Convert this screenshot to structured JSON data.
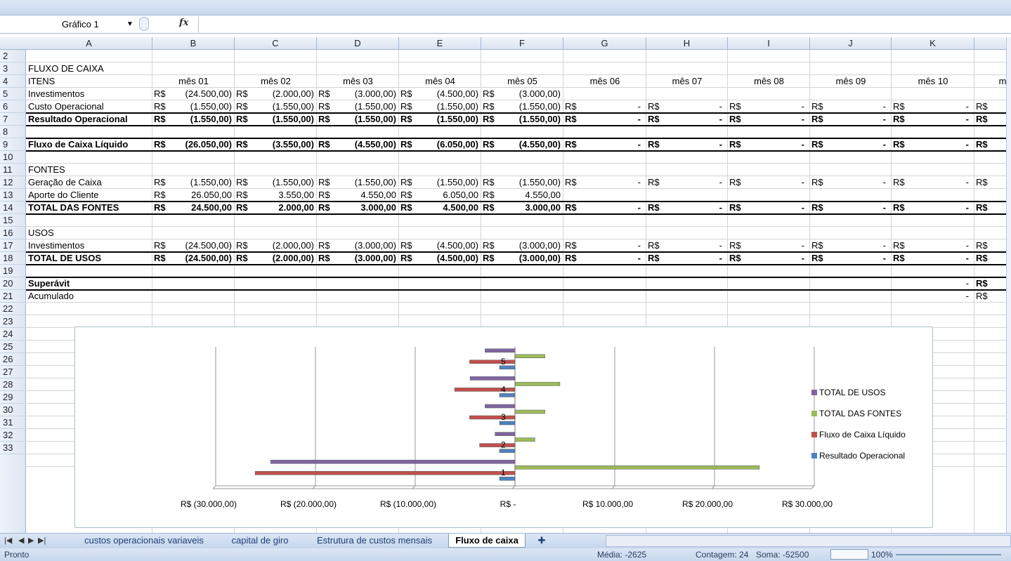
{
  "name_box": "Gráfico 1",
  "fx_label": "fx",
  "col_headers": [
    "A",
    "B",
    "C",
    "D",
    "E",
    "F",
    "G",
    "H",
    "I",
    "J",
    "K"
  ],
  "row_numbers": [
    "2",
    "3",
    "4",
    "5",
    "6",
    "7",
    "8",
    "9",
    "10",
    "11",
    "12",
    "13",
    "14",
    "15",
    "16",
    "17",
    "18",
    "19",
    "20",
    "21",
    "22",
    "23",
    "24",
    "25",
    "26",
    "27",
    "28",
    "29",
    "30",
    "31",
    "32",
    "33"
  ],
  "rows": {
    "r3": {
      "a": "FLUXO DE CAIXA"
    },
    "r4": {
      "a": "ITENS",
      "months": [
        "mês 01",
        "mês 02",
        "mês 03",
        "mês 04",
        "mês 05",
        "mês 06",
        "mês 07",
        "mês 08",
        "mês 09",
        "mês 10",
        "m"
      ]
    },
    "r5": {
      "a": "Investimentos",
      "vals": [
        "(24.500,00)",
        "(2.000,00)",
        "(3.000,00)",
        "(4.500,00)",
        "(3.000,00)"
      ]
    },
    "r6": {
      "a": "Custo Operacional",
      "vals": [
        "(1.550,00)",
        "(1.550,00)",
        "(1.550,00)",
        "(1.550,00)",
        "(1.550,00)"
      ]
    },
    "r7": {
      "a": "Resultado Operacional",
      "vals": [
        "(1.550,00)",
        "(1.550,00)",
        "(1.550,00)",
        "(1.550,00)",
        "(1.550,00)"
      ]
    },
    "r9": {
      "a": "Fluxo de Caixa Líquido",
      "vals": [
        "(26.050,00)",
        "(3.550,00)",
        "(4.550,00)",
        "(6.050,00)",
        "(4.550,00)"
      ]
    },
    "r11": {
      "a": "FONTES"
    },
    "r12": {
      "a": "Geração de Caixa",
      "vals": [
        "(1.550,00)",
        "(1.550,00)",
        "(1.550,00)",
        "(1.550,00)",
        "(1.550,00)"
      ]
    },
    "r13": {
      "a": "Aporte do Cliente",
      "vals": [
        "26.050,00",
        "3.550,00",
        "4.550,00",
        "6.050,00",
        "4.550,00"
      ]
    },
    "r14": {
      "a": "TOTAL DAS FONTES",
      "vals": [
        "24.500,00",
        "2.000,00",
        "3.000,00",
        "4.500,00",
        "3.000,00"
      ]
    },
    "r16": {
      "a": "USOS"
    },
    "r17": {
      "a": "Investimentos",
      "vals": [
        "(24.500,00)",
        "(2.000,00)",
        "(3.000,00)",
        "(4.500,00)",
        "(3.000,00)"
      ]
    },
    "r18": {
      "a": "TOTAL DE USOS",
      "vals": [
        "(24.500,00)",
        "(2.000,00)",
        "(3.000,00)",
        "(4.500,00)",
        "(3.000,00)"
      ]
    },
    "r20": {
      "a": "Superávit"
    },
    "r21": {
      "a": "Acumulado"
    }
  },
  "currency": "R$",
  "dash": "-",
  "chart_data": {
    "type": "bar",
    "orientation": "horizontal",
    "categories": [
      "1",
      "2",
      "3",
      "4",
      "5"
    ],
    "series": [
      {
        "name": "Resultado Operacional",
        "color": "#4f81bd",
        "values": [
          -1550,
          -1550,
          -1550,
          -1550,
          -1550
        ]
      },
      {
        "name": "Fluxo de Caixa Líquido",
        "color": "#c0504d",
        "values": [
          -26050,
          -3550,
          -4550,
          -6050,
          -4550
        ]
      },
      {
        "name": "TOTAL DAS FONTES",
        "color": "#9bbb59",
        "values": [
          24500,
          2000,
          3000,
          4500,
          3000
        ]
      },
      {
        "name": "TOTAL DE USOS",
        "color": "#8064a2",
        "values": [
          -24500,
          -2000,
          -3000,
          -4500,
          -3000
        ]
      }
    ],
    "xlim": [
      -30000,
      30000
    ],
    "x_ticks": [
      -30000,
      -20000,
      -10000,
      0,
      10000,
      20000,
      30000
    ],
    "x_tick_labels": [
      "R$ (30.000,00)",
      "R$ (20.000,00)",
      "R$ (10.000,00)",
      "R$ -",
      "R$ 10.000,00",
      "R$ 20.000,00",
      "R$ 30.000,00"
    ],
    "legend_position": "right",
    "grid": true
  },
  "tabs": [
    "custos operacionais variaveis",
    "capital de giro",
    "Estrutura de custos mensais",
    "Fluxo de caixa"
  ],
  "status": {
    "ready": "Pronto",
    "media": "Média: -2625",
    "contagem": "Contagem: 24",
    "soma": "Soma: -52500",
    "zoom": "100%"
  }
}
